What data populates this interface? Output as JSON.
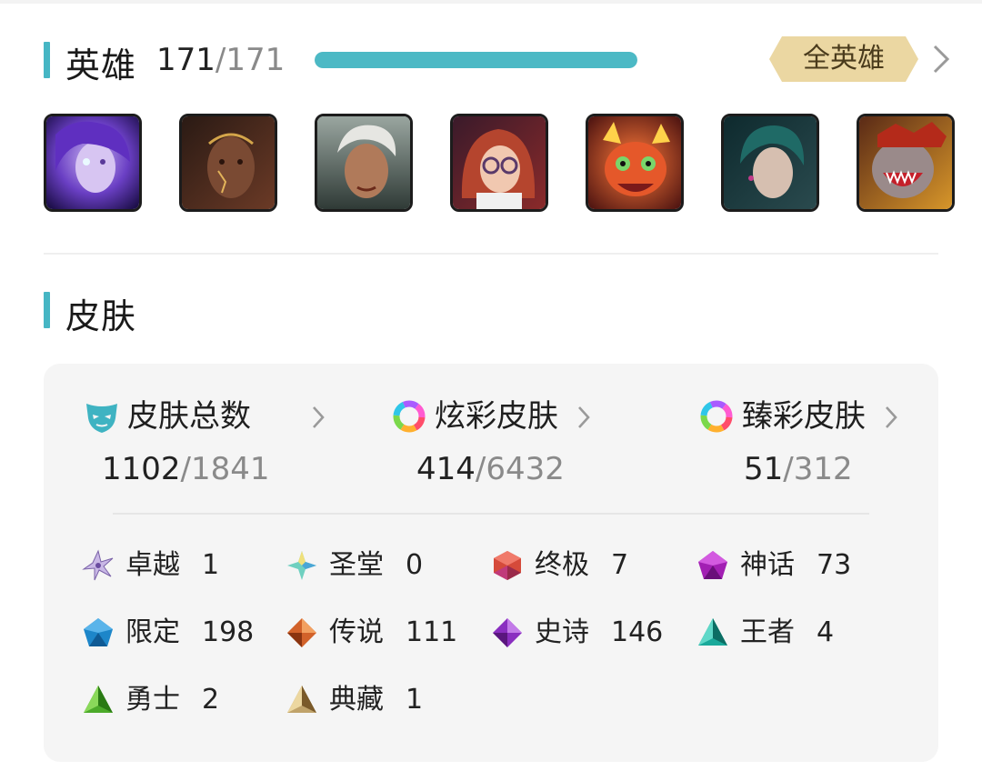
{
  "heroes": {
    "title": "英雄",
    "owned": "171",
    "separator": "/",
    "total": "171",
    "progress_fraction": 1.0,
    "all_heroes_label": "全英雄",
    "accent_color": "#46b6c4",
    "badge_color": "#e8d3a0",
    "avatars": [
      {
        "icon": "champion-portrait-purple-hair"
      },
      {
        "icon": "champion-portrait-dark-skin-gold"
      },
      {
        "icon": "champion-portrait-silver-hair"
      },
      {
        "icon": "champion-portrait-red-hair-glasses"
      },
      {
        "icon": "champion-portrait-orange-creature"
      },
      {
        "icon": "champion-portrait-teal-hair"
      },
      {
        "icon": "champion-portrait-red-beast"
      }
    ]
  },
  "skins": {
    "title": "皮肤",
    "stats": [
      {
        "label": "皮肤总数",
        "owned": "1102",
        "separator": "/",
        "total": "1841",
        "icon": "mask-icon"
      },
      {
        "label": "炫彩皮肤",
        "owned": "414",
        "separator": "/",
        "total": "6432",
        "icon": "rainbow-ring-icon"
      },
      {
        "label": "臻彩皮肤",
        "owned": "51",
        "separator": "/",
        "total": "312",
        "icon": "rainbow-ring-icon"
      }
    ],
    "rarities": [
      {
        "name": "卓越",
        "count": "1",
        "icon": "transcendent-gem-icon",
        "color": "#b9a7d6"
      },
      {
        "name": "圣堂",
        "count": "0",
        "icon": "exalted-gem-icon",
        "color": "#5fc7c2"
      },
      {
        "name": "终极",
        "count": "7",
        "icon": "ultimate-gem-icon",
        "color": "#d2463a"
      },
      {
        "name": "神话",
        "count": "73",
        "icon": "mythic-gem-icon",
        "color": "#a21fb3"
      },
      {
        "name": "限定",
        "count": "198",
        "icon": "limited-gem-icon",
        "color": "#1d86c9"
      },
      {
        "name": "传说",
        "count": "111",
        "icon": "legendary-gem-icon",
        "color": "#d2622a"
      },
      {
        "name": "史诗",
        "count": "146",
        "icon": "epic-gem-icon",
        "color": "#8a2ec0"
      },
      {
        "name": "王者",
        "count": "4",
        "icon": "monarch-gem-icon",
        "color": "#1aa99a"
      },
      {
        "name": "勇士",
        "count": "2",
        "icon": "warrior-gem-icon",
        "color": "#4caa2a"
      },
      {
        "name": "典藏",
        "count": "1",
        "icon": "collection-gem-icon",
        "color": "#c0a36a"
      }
    ]
  }
}
